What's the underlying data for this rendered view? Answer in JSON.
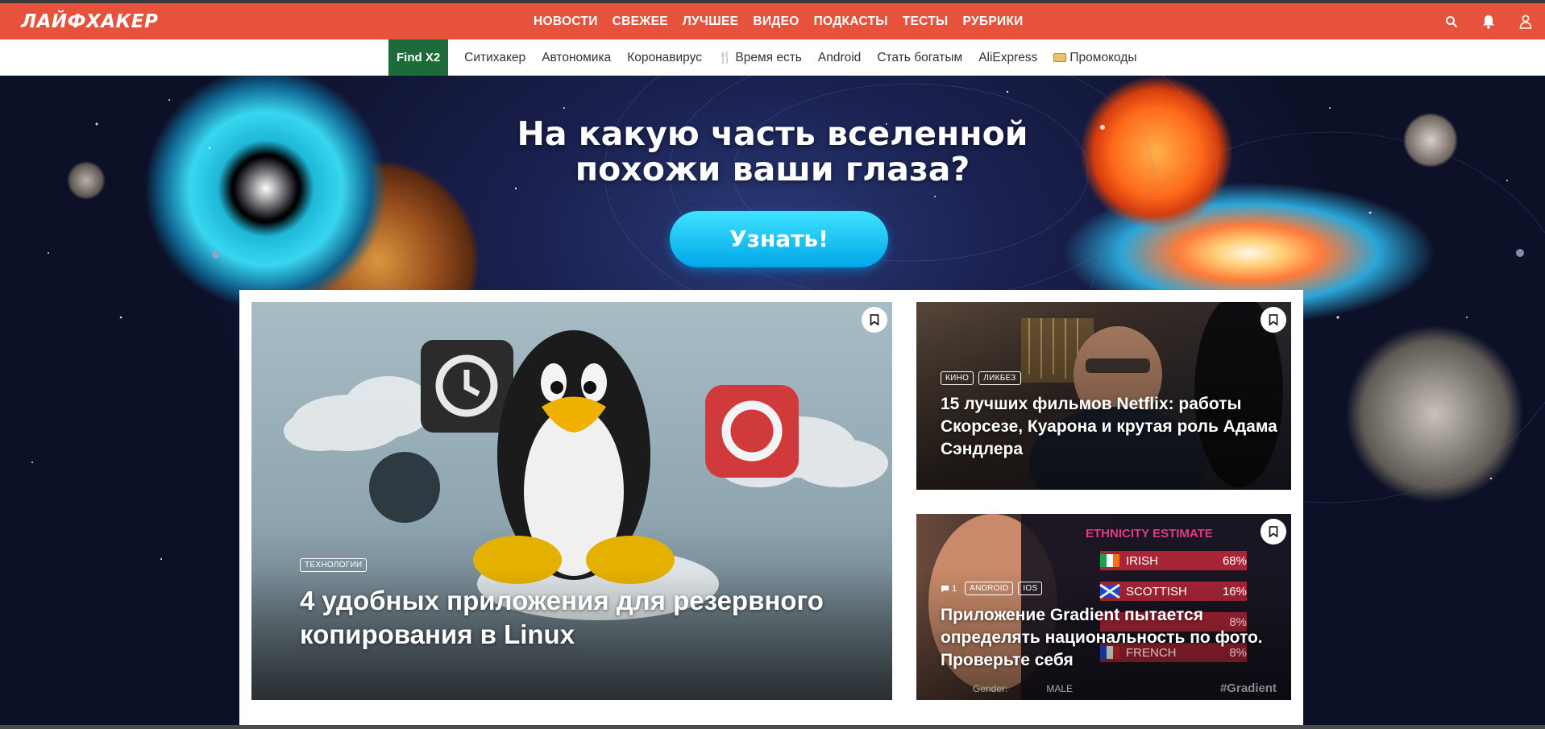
{
  "header": {
    "logo": "ЛАЙФХАКЕР",
    "nav": [
      "НОВОСТИ",
      "СВЕЖЕЕ",
      "ЛУЧШЕЕ",
      "ВИДЕО",
      "ПОДКАСТЫ",
      "ТЕСТЫ",
      "РУБРИКИ"
    ],
    "icons": [
      "search-icon",
      "bell-icon",
      "user-icon"
    ],
    "brand_color": "#e6523b"
  },
  "subnav": {
    "pill": "Find X2",
    "items": [
      "Ситихакер",
      "Автономика",
      "Коронавирус",
      "Время есть",
      "Android",
      "Стать богатым",
      "AliExpress",
      "Промокоды"
    ],
    "pill_color": "#1e6b3a"
  },
  "hero": {
    "title_line1": "На какую часть вселенной",
    "title_line2": "похожи ваши глаза?",
    "cta": "Узнать!"
  },
  "cards": [
    {
      "tags": [
        "ТЕХНОЛОГИИ"
      ],
      "title_line1": "4 удобных приложения для резервного",
      "title_line2": "копирования в Linux"
    },
    {
      "tags": [
        "КИНО",
        "ЛИКБЕЗ"
      ],
      "title_line1": "15 лучших фильмов Netflix: работы",
      "title_line2": "Скорсезе, Куарона и крутая роль Адама",
      "title_line3": "Сэндлера"
    },
    {
      "comments": "1",
      "tags": [
        "ANDROID",
        "IOS"
      ],
      "title_line1": "Приложение Gradient пытается",
      "title_line2": "определять национальность по фото.",
      "title_line3": "Проверьте себя",
      "image_text": {
        "heading": "ETHNICITY ESTIMATE",
        "rows": [
          {
            "label": "IRISH",
            "value": "68%"
          },
          {
            "label": "SCOTTISH",
            "value": "16%"
          },
          {
            "label": "",
            "value": "8%"
          },
          {
            "label": "FRENCH",
            "value": "8%"
          }
        ],
        "gender_label": "Gender:",
        "gender_value": "MALE",
        "hashtag": "#Gradient"
      }
    }
  ]
}
